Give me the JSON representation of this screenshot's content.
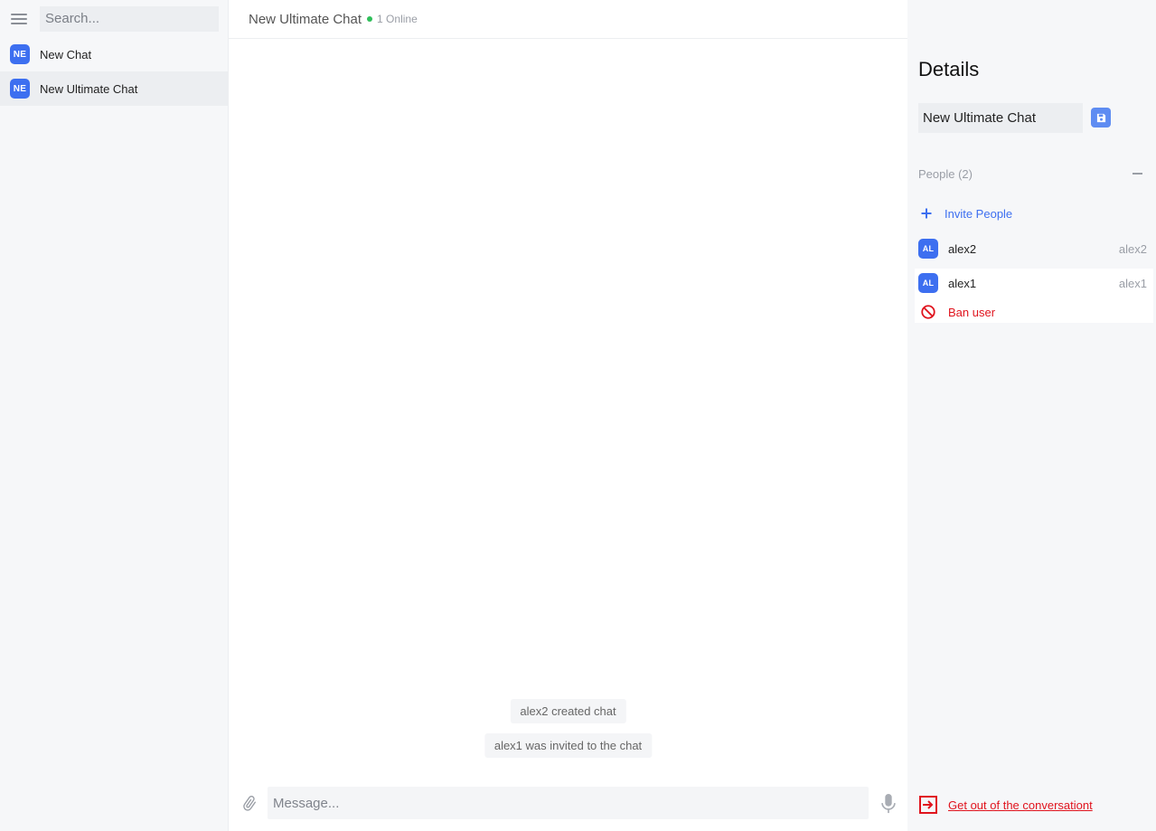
{
  "sidebar": {
    "search_placeholder": "Search...",
    "chats": [
      {
        "avatar": "NE",
        "label": "New Chat",
        "active": false
      },
      {
        "avatar": "NE",
        "label": "New Ultimate Chat",
        "active": true
      }
    ]
  },
  "main": {
    "header": {
      "title": "New Ultimate Chat",
      "online_text": "1 Online"
    },
    "system_messages": [
      "alex2 created chat",
      "alex1 was invited to the chat"
    ],
    "composer": {
      "placeholder": "Message..."
    }
  },
  "details": {
    "title": "Details",
    "chat_name_value": "New Ultimate Chat",
    "people_header": "People (2)",
    "invite_label": "Invite People",
    "people": [
      {
        "avatar": "AL",
        "name": "alex2",
        "username": "alex2"
      },
      {
        "avatar": "AL",
        "name": "alex1",
        "username": "alex1"
      }
    ],
    "ban_label": "Ban user",
    "leave_label": "Get out of the conversationt"
  },
  "colors": {
    "accent": "#3d6ff0",
    "online": "#2fbf5a",
    "danger": "#e0141e",
    "sidebar_bg": "#f6f7f9"
  },
  "icons": {
    "menu": "hamburger-menu-icon",
    "attach": "paperclip-icon",
    "mic": "microphone-icon",
    "save": "floppy-disk-icon",
    "collapse": "minus-icon",
    "invite": "plus-icon",
    "ban": "no-entry-icon",
    "leave": "exit-icon"
  }
}
